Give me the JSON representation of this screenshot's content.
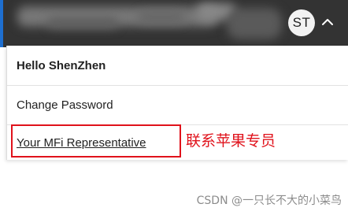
{
  "header": {
    "avatar_initials": "ST",
    "menu_chevron_icon": "chevron-up-icon",
    "accent_color": "#1e6fd0",
    "bar_color": "#333333"
  },
  "dropdown": {
    "greeting": "Hello ShenZhen",
    "items": [
      {
        "label": "Change Password"
      },
      {
        "label": "Your MFi Representative"
      }
    ]
  },
  "annotation": {
    "text": "联系苹果专员",
    "color": "#e0121b"
  },
  "watermark": {
    "text": "CSDN @一只长不大的小菜鸟"
  }
}
